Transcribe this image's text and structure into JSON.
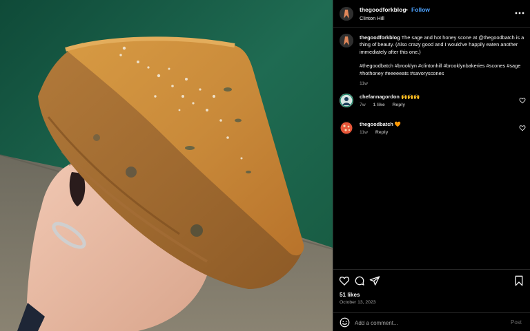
{
  "header": {
    "username": "thegoodforkblog",
    "separator": "•",
    "follow_label": "Follow",
    "location": "Clinton Hill",
    "more_icon": "more-horizontal-icon"
  },
  "caption": {
    "username": "thegoodforkblog",
    "text": "The sage and hot honey scone at @thegoodbatch is a thing of beauty. (Also crazy good and I would've happily eaten another immediately after this one.)",
    "hashtags": "#thegoodbatch #brooklyn #clintonhill #brooklynbakeries #scones #sage #hothoney #eeeeeats #savoryscones",
    "time": "11w"
  },
  "comments": [
    {
      "username": "chefannagordon",
      "text": "🙌🙌🙌",
      "time": "7w",
      "likes": "1 like",
      "reply_label": "Reply"
    },
    {
      "username": "thegoodbatch",
      "text": "🧡",
      "time": "11w",
      "reply_label": "Reply"
    }
  ],
  "actions": {
    "likes": "51 likes",
    "date": "October 13, 2023",
    "comment_placeholder": "Add a comment...",
    "post_label": "Post",
    "icons": [
      "heart-icon",
      "comment-icon",
      "share-icon",
      "bookmark-icon",
      "emoji-icon"
    ]
  },
  "colors": {
    "accent_follow": "#4da3ff",
    "background": "#000000",
    "muted_text": "#a8a8a8",
    "divider": "#262626"
  }
}
